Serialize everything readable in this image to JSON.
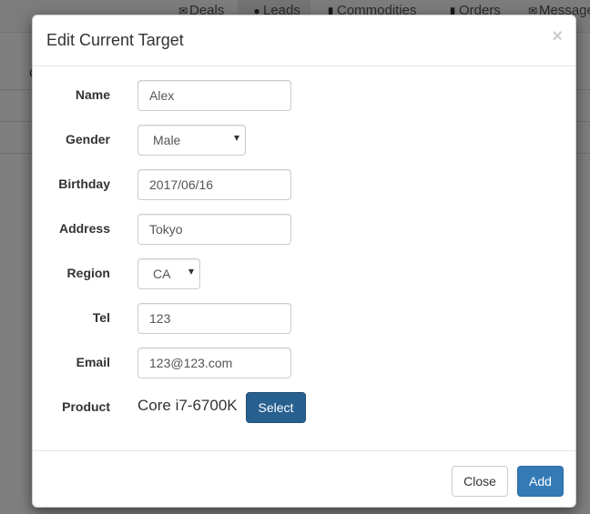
{
  "background_nav": {
    "items": [
      {
        "label": "Deals",
        "icon": "envelope-icon"
      },
      {
        "label": "Leads",
        "icon": "user-icon"
      },
      {
        "label": "Commodities",
        "icon": "file-icon"
      },
      {
        "label": "Orders",
        "icon": "file-icon"
      },
      {
        "label": "Message",
        "icon": "envelope-icon"
      }
    ],
    "page_letter": "C"
  },
  "modal": {
    "title": "Edit Current Target",
    "close_symbol": "×",
    "fields": {
      "name": {
        "label": "Name",
        "value": "Alex"
      },
      "gender": {
        "label": "Gender",
        "value": "Male"
      },
      "birthday": {
        "label": "Birthday",
        "value": "2017/06/16"
      },
      "address": {
        "label": "Address",
        "value": "Tokyo"
      },
      "region": {
        "label": "Region",
        "value": "CA"
      },
      "tel": {
        "label": "Tel",
        "value": "123"
      },
      "email": {
        "label": "Email",
        "value": "123@123.com"
      },
      "product": {
        "label": "Product",
        "value": "Core i7-6700K",
        "select_label": "Select"
      }
    },
    "footer": {
      "close_label": "Close",
      "add_label": "Add"
    }
  },
  "colors": {
    "primary": "#337ab7",
    "primary_dark": "#286090",
    "backdrop": "rgba(0,0,0,0.5)"
  }
}
